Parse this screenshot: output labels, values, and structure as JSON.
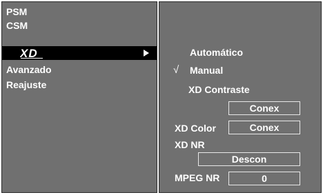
{
  "left_menu": {
    "items": [
      {
        "label": "PSM"
      },
      {
        "label": "CSM"
      },
      {
        "label": "XD"
      },
      {
        "label": "Avanzado"
      },
      {
        "label": "Reajuste"
      }
    ]
  },
  "xd_submenu": {
    "options": {
      "automatico": "Automático",
      "manual": "Manual",
      "xd_contraste": "XD Contraste"
    },
    "manual_checkmark": "√",
    "xd_contraste_value": "Conex",
    "xd_color_label": "XD Color",
    "xd_color_value": "Conex",
    "xd_nr_label": "XD NR",
    "xd_nr_value": "Descon",
    "mpeg_nr_label": "MPEG NR",
    "mpeg_nr_value": "0"
  },
  "colors": {
    "panel_bg": "#707070",
    "selected_bg": "#000000",
    "text": "#ffffff"
  }
}
